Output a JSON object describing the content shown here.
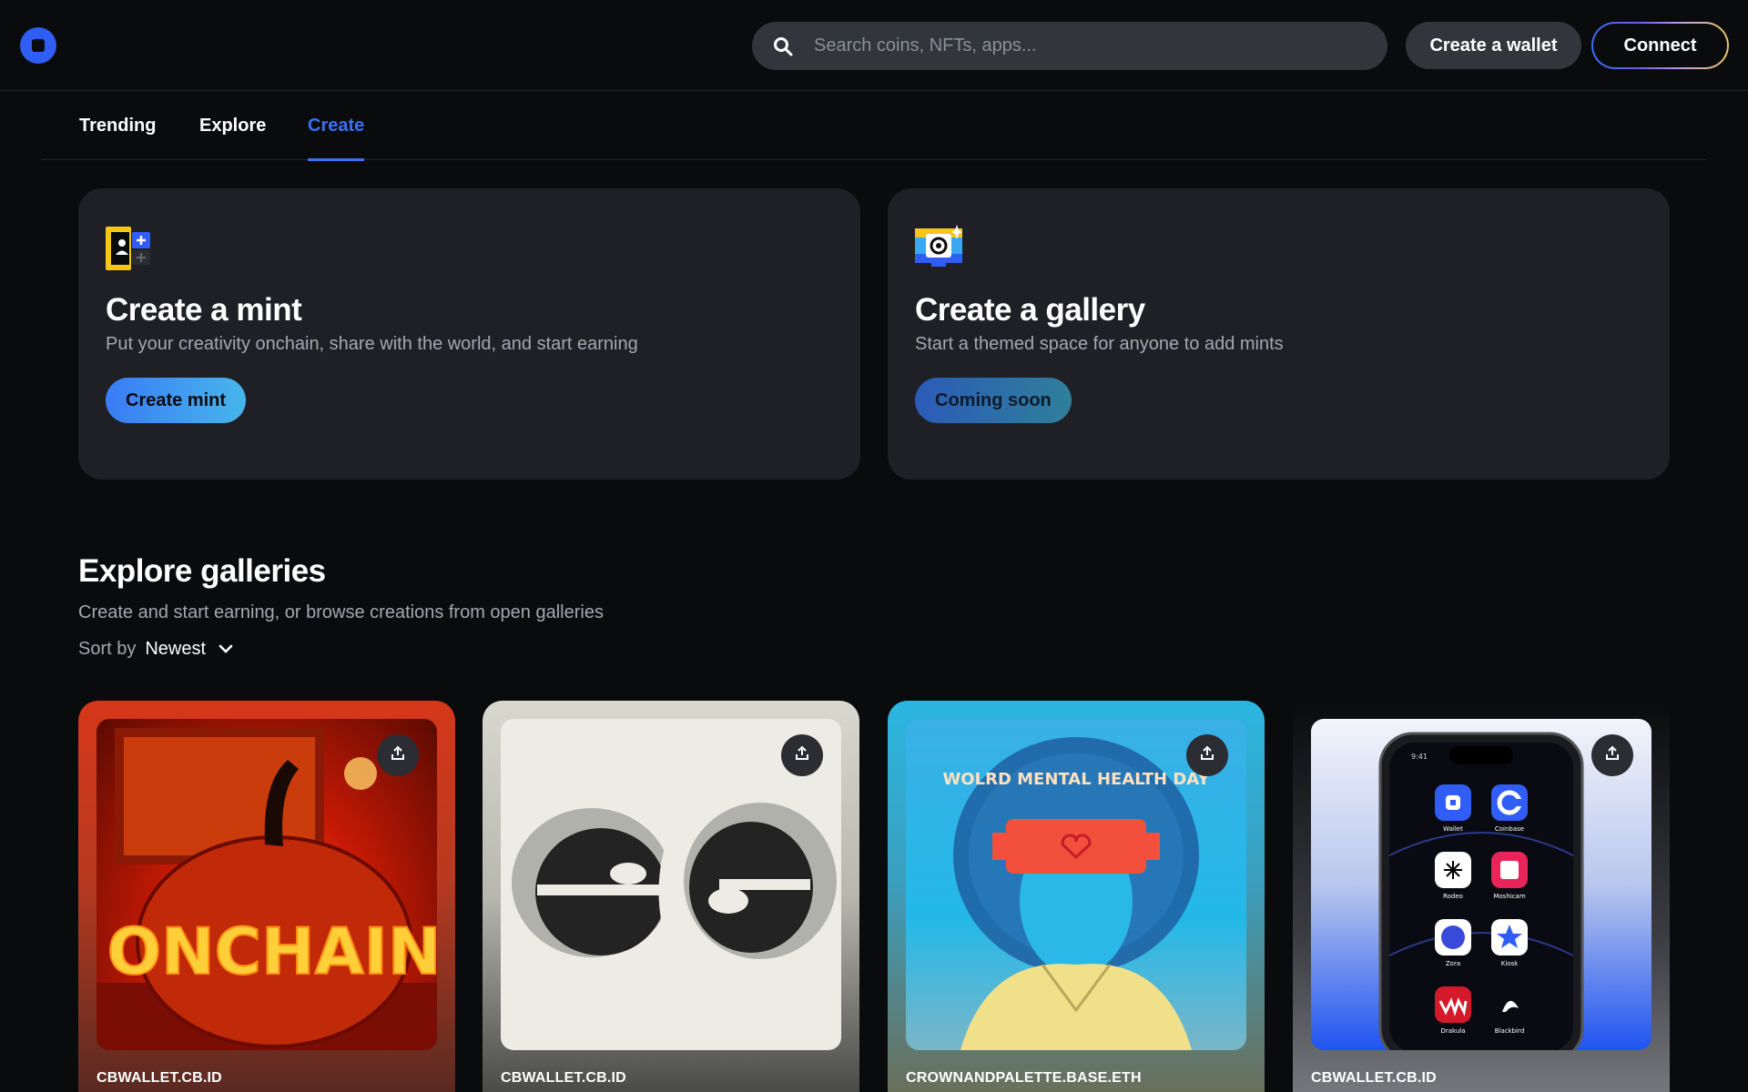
{
  "header": {
    "search_placeholder": "Search coins, NFTs, apps...",
    "create_wallet_label": "Create a wallet",
    "connect_label": "Connect"
  },
  "tabs": [
    {
      "label": "Trending"
    },
    {
      "label": "Explore"
    },
    {
      "label": "Create",
      "active": true
    }
  ],
  "cards": {
    "mint": {
      "title": "Create a mint",
      "subtitle": "Put your creativity onchain, share with the world, and start earning",
      "button": "Create mint"
    },
    "gallery": {
      "title": "Create a gallery",
      "subtitle": "Start a themed space for anyone to add mints",
      "button": "Coming soon"
    }
  },
  "explore": {
    "title": "Explore galleries",
    "subtitle": "Create and start earning, or browse creations from open galleries",
    "sort_label": "Sort by",
    "sort_value": "Newest"
  },
  "galleries": [
    {
      "creator": "CBWALLET.CB.ID",
      "art_text": "ONCHAIN"
    },
    {
      "creator": "CBWALLET.CB.ID"
    },
    {
      "creator": "CROWNANDPALETTE.BASE.ETH",
      "art_text": "WOLRD MENTAL HEALTH DAY"
    },
    {
      "creator": "CBWALLET.CB.ID",
      "phone": {
        "time": "9:41",
        "apps": [
          "Wallet",
          "Coinbase",
          "Rodeo",
          "Moshicam",
          "Zora",
          "Kiosk",
          "Drakula",
          "Blackbird"
        ]
      }
    }
  ],
  "colors": {
    "accent": "#3b6ff5",
    "background": "#0a0b0d",
    "card": "#1e2025"
  }
}
